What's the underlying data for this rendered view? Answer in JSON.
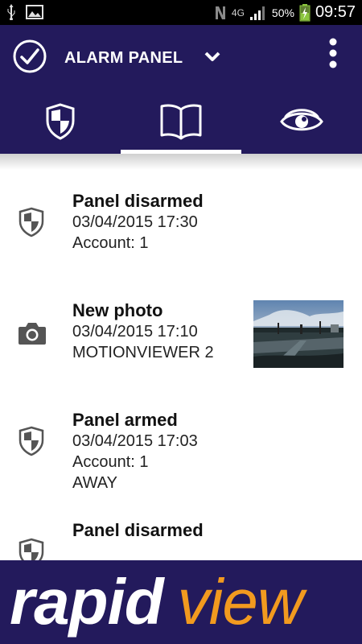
{
  "status_bar": {
    "signal_label": "4G",
    "battery": "50%",
    "time": "09:57"
  },
  "app_bar": {
    "title": "ALARM PANEL",
    "tabs": [
      {
        "name": "security",
        "icon": "shield-icon"
      },
      {
        "name": "log",
        "icon": "book-icon",
        "selected": true
      },
      {
        "name": "view",
        "icon": "eye-icon"
      }
    ]
  },
  "events": [
    {
      "title": "Panel disarmed",
      "datetime": "03/04/2015 17:30",
      "line2": "Account: 1",
      "icon": "shield-icon"
    },
    {
      "title": "New photo",
      "datetime": "03/04/2015 17:10",
      "line2": "MOTIONVIEWER 2",
      "icon": "camera-icon"
    },
    {
      "title": "Panel armed",
      "datetime": "03/04/2015 17:03",
      "line2": "Account: 1",
      "line3": "AWAY",
      "icon": "shield-icon"
    },
    {
      "title": "Panel disarmed",
      "icon": "shield-icon"
    }
  ],
  "banner": {
    "brand_part1": "rapid",
    "brand_part2": "view"
  },
  "colors": {
    "primary": "#231a5c",
    "brand_accent": "#f29a1f"
  }
}
